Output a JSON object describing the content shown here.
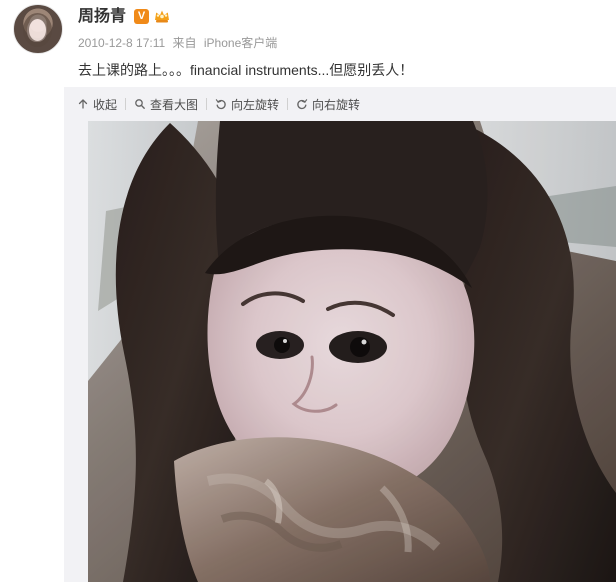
{
  "post": {
    "username": "周扬青",
    "badge_v": "V",
    "timestamp": "2010-12-8 17:11",
    "source_prefix": "来自",
    "source_client": "iPhone客户端",
    "content": "去上课的路上。。。financial instruments...但愿别丢人！"
  },
  "toolbar": {
    "collapse_label": "收起",
    "view_large_label": "查看大图",
    "rotate_left_label": "向左旋转",
    "rotate_right_label": "向右旋转"
  },
  "icons": {
    "collapse": "collapse-icon",
    "view_large": "search-icon",
    "rotate_left": "rotate-left-icon",
    "rotate_right": "rotate-right-icon"
  },
  "colors": {
    "text": "#333333",
    "meta": "#999999",
    "toolbar_bg": "#f2f2f5",
    "verified_badge": "#f08a19"
  }
}
